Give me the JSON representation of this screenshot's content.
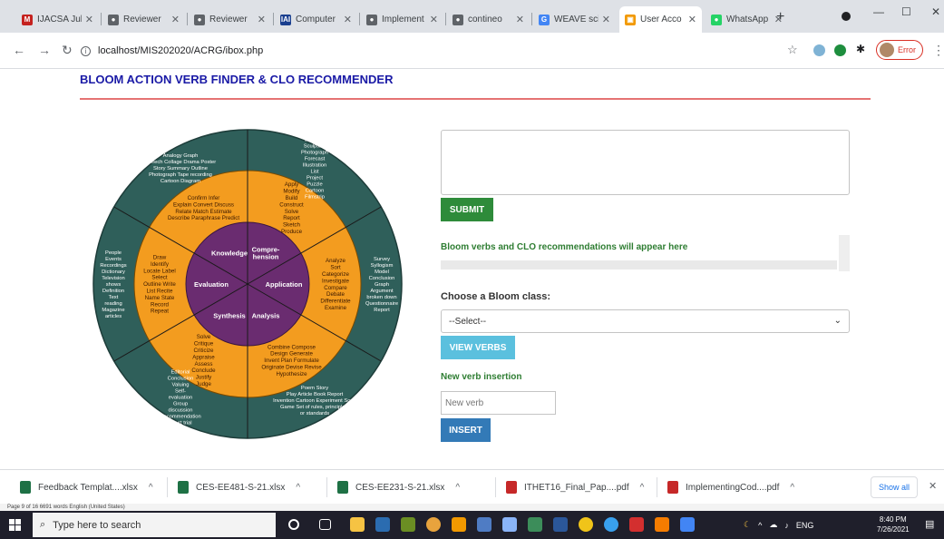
{
  "browser": {
    "tabs": [
      {
        "label": "IJACSA July",
        "favicon": "M",
        "color": "#c5221f"
      },
      {
        "label": "Reviewer",
        "favicon": "●",
        "color": "#5f6368"
      },
      {
        "label": "Reviewer",
        "favicon": "●",
        "color": "#5f6368"
      },
      {
        "label": "Computer",
        "favicon": "IAI",
        "color": "#1a3f8f"
      },
      {
        "label": "Implement",
        "favicon": "●",
        "color": "#5f6368"
      },
      {
        "label": "contineo",
        "favicon": "●",
        "color": "#5f6368"
      },
      {
        "label": "WEAVE sci",
        "favicon": "G",
        "color": "#4285f4"
      },
      {
        "label": "User Acco",
        "favicon": "▣",
        "color": "#f29900",
        "active": true
      },
      {
        "label": "WhatsApp",
        "favicon": "●",
        "color": "#25d366"
      }
    ],
    "url": "localhost/MIS202020/ACRG/ibox.php",
    "profile_label": "Error"
  },
  "page": {
    "title": "BLOOM ACTION VERB FINDER & CLO RECOMMENDER",
    "submit_label": "SUBMIT",
    "result_text": "Bloom verbs and CLO recommendations will appear here",
    "choose_label": "Choose a Bloom class:",
    "select_value": "--Select--",
    "view_label": "VIEW VERBS",
    "insert_heading": "New verb insertion",
    "new_verb_placeholder": "New verb",
    "insert_label": "INSERT"
  },
  "wheel": {
    "colors": {
      "outer": "#2f5f5a",
      "middle": "#f39c1f",
      "inner": "#6a2c70"
    },
    "center_labels": [
      "Knowledge",
      "Compre-\nhension",
      "Application",
      "Analysis",
      "Synthesis",
      "Evaluation"
    ],
    "verb_lines": [
      [
        "Confirm  Infer",
        "Explain Convert Discuss",
        "Relate  Match  Estimate",
        "Describe  Paraphrase  Predict"
      ],
      [
        "Apply",
        "Modify",
        "Build",
        "Construct",
        "Solve",
        "Report",
        "Sketch",
        "Produce"
      ],
      [
        "Analyze",
        "Sort",
        "Categorize",
        "Investigate",
        "Compare",
        "Debate",
        "Differentiate",
        "Examine"
      ],
      [
        "Combine  Compose",
        "Design  Generate",
        "Invent  Plan  Formulate",
        "Originate  Devise  Revise",
        "Hypothesize"
      ],
      [
        "Solve",
        "Critique",
        "Criticize",
        "Appraise",
        "Assess",
        "Conclude",
        "Justify",
        "Judge"
      ],
      [
        "Draw",
        "Identify",
        "Locate  Label",
        "Select",
        "Outline  Write",
        "List  Recite",
        "Name  State",
        "Record",
        "Repeat"
      ]
    ],
    "product_lines": [
      [
        "Analogy  Graph",
        "Speech Collage Drama Poster",
        "Story    Summary  Outline",
        "Photograph  Tape recording",
        "Cartoon              Diagram"
      ],
      [
        "Diagram",
        "Sculpture",
        "Photograph",
        "Forecast",
        "Illustration",
        "List",
        "Project",
        "Puzzle",
        "Cartoon",
        "Filmstrip"
      ],
      [
        "Survey",
        "Syllogism",
        "Model",
        "Conclusion",
        "Graph",
        "Argument",
        "broken down",
        "Questionnaire",
        "Report"
      ],
      [
        "Poem            Story",
        "Play  Article  Book  Report",
        "Invention  Cartoon  Experiment  Song",
        "Game   Set of rules, principles,",
        "or standards"
      ],
      [
        "Editorial",
        "Conclusion",
        "Valuing",
        "Self-",
        "evaluation",
        "Group",
        "discussion",
        "Recommendation",
        "Court trial",
        "Survey"
      ],
      [
        "People",
        "Events",
        "Recordings",
        "Dictionary",
        "Television",
        "shows",
        "Definition",
        "Text",
        "reading",
        "Magazine",
        "articles"
      ]
    ]
  },
  "downloads": [
    {
      "name": "Feedback Templat....xlsx",
      "type": "xlsx"
    },
    {
      "name": "CES-EE481-S-21.xlsx",
      "type": "xlsx"
    },
    {
      "name": "CES-EE231-S-21.xlsx",
      "type": "xlsx"
    },
    {
      "name": "ITHET16_Final_Pap....pdf",
      "type": "pdf"
    },
    {
      "name": "ImplementingCod....pdf",
      "type": "pdf"
    }
  ],
  "show_all_label": "Show all",
  "word_status": "Page 9 of 16    6691 words    English (United States)",
  "taskbar": {
    "search_placeholder": "Type here to search",
    "tray_lang": "ENG",
    "time": "8:40 PM",
    "date": "7/26/2021"
  }
}
